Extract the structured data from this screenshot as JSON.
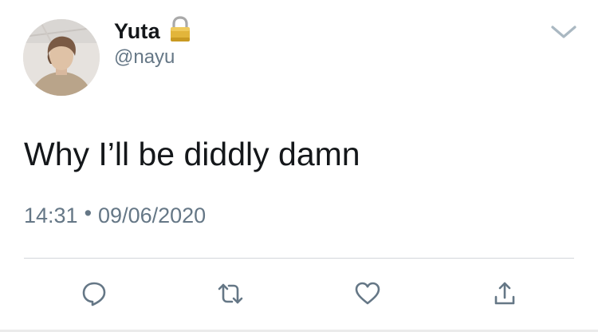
{
  "author": {
    "display_name": "Yuta",
    "handle": "@nayu",
    "protected_icon": "lock-icon"
  },
  "tweet": {
    "text": "Why I’ll be diddly damn",
    "time": "14:31",
    "separator": "•",
    "date": "09/06/2020"
  },
  "actions": [
    {
      "name": "reply",
      "icon": "reply-bubble-icon"
    },
    {
      "name": "retweet",
      "icon": "retweet-icon"
    },
    {
      "name": "like",
      "icon": "heart-icon"
    },
    {
      "name": "share",
      "icon": "share-upload-icon"
    }
  ],
  "menu_icon": "chevron-down-icon",
  "colors": {
    "text": "#14171a",
    "secondary": "#657786",
    "divider": "#d3d6da",
    "lock_gold": "#e2b53b"
  }
}
